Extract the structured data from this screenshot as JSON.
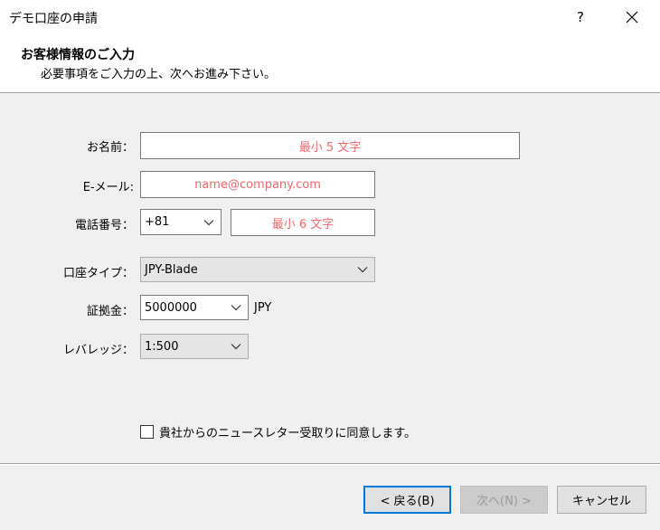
{
  "window": {
    "title": "デモ口座の申請",
    "help_label": "?"
  },
  "header": {
    "title": "お客様情報のご入力",
    "subtitle": "必要事項をご入力の上、次へお進み下さい。"
  },
  "form": {
    "name": {
      "label": "お名前：",
      "placeholder": "最小 5 文字"
    },
    "email": {
      "label": "E-メール:",
      "placeholder": "name@company.com"
    },
    "phone": {
      "label": "電話番号：",
      "country_code": "+81",
      "placeholder": "最小 6 文字"
    },
    "account_type": {
      "label": "口座タイプ：",
      "value": "JPY-Blade"
    },
    "deposit": {
      "label": "証拠金：",
      "value": "5000000",
      "currency": "JPY"
    },
    "leverage": {
      "label": "レバレッジ：",
      "value": "1:500"
    },
    "newsletter": {
      "label": "貴社からのニュースレター受取りに同意します。",
      "checked": false
    }
  },
  "buttons": {
    "back": "< 戻る(B)",
    "next": "次へ(N) >",
    "cancel": "キャンセル"
  },
  "colors": {
    "placeholder": "#f0696b",
    "focus_border": "#0078d7"
  }
}
